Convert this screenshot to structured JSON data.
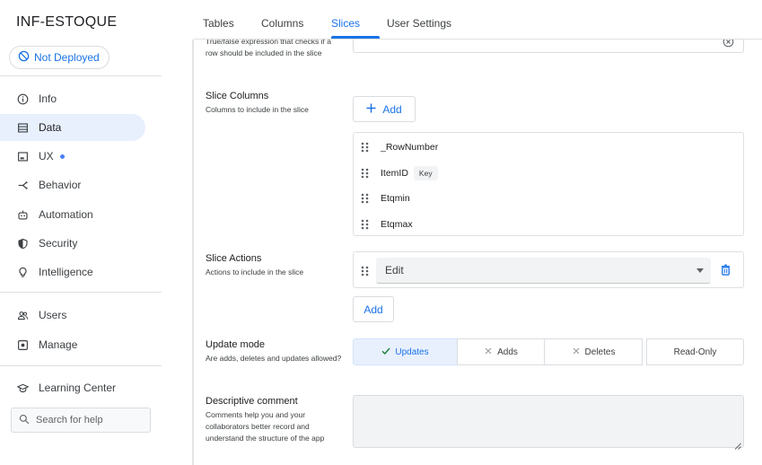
{
  "app": {
    "title": "INF-ESTOQUE",
    "deploy_status": "Not Deployed"
  },
  "sidebar": {
    "items": [
      {
        "label": "Info",
        "icon": "info-icon"
      },
      {
        "label": "Data",
        "icon": "table-icon",
        "active": true
      },
      {
        "label": "UX",
        "icon": "ux-icon",
        "has_dot": true
      },
      {
        "label": "Behavior",
        "icon": "behavior-icon"
      },
      {
        "label": "Automation",
        "icon": "robot-icon"
      },
      {
        "label": "Security",
        "icon": "shield-icon"
      },
      {
        "label": "Intelligence",
        "icon": "lightbulb-icon"
      },
      {
        "label": "Users",
        "icon": "users-icon"
      },
      {
        "label": "Manage",
        "icon": "manage-icon"
      },
      {
        "label": "Learning Center",
        "icon": "graduation-cap-icon"
      }
    ],
    "search_placeholder": "Search for help"
  },
  "tabs": [
    {
      "label": "Tables"
    },
    {
      "label": "Columns"
    },
    {
      "label": "Slices",
      "active": true
    },
    {
      "label": "User Settings"
    }
  ],
  "slice": {
    "filter": {
      "description": "True/false expression that checks if a row should be included in the slice"
    },
    "columns": {
      "label": "Slice Columns",
      "description": "Columns to include in the slice",
      "add_label": "Add",
      "items": [
        {
          "name": "_RowNumber"
        },
        {
          "name": "ItemID",
          "badge": "Key"
        },
        {
          "name": "Etqmin"
        },
        {
          "name": "Etqmax"
        }
      ]
    },
    "actions": {
      "label": "Slice Actions",
      "description": "Actions to include in the slice",
      "selected": "Edit",
      "add_label": "Add"
    },
    "update_mode": {
      "label": "Update mode",
      "description": "Are adds, deletes and updates allowed?",
      "options": [
        {
          "label": "Updates",
          "mark": "check",
          "selected": true
        },
        {
          "label": "Adds",
          "mark": "x"
        },
        {
          "label": "Deletes",
          "mark": "x"
        },
        {
          "label": "Read-Only",
          "mark": "none"
        }
      ]
    },
    "comment": {
      "label": "Descriptive comment",
      "description": "Comments help you and your collaborators better record and understand the structure of the app"
    }
  },
  "colors": {
    "accent": "#1a73e8",
    "active_bg": "#e8f0fe",
    "field_bg": "#f1f3f4"
  }
}
